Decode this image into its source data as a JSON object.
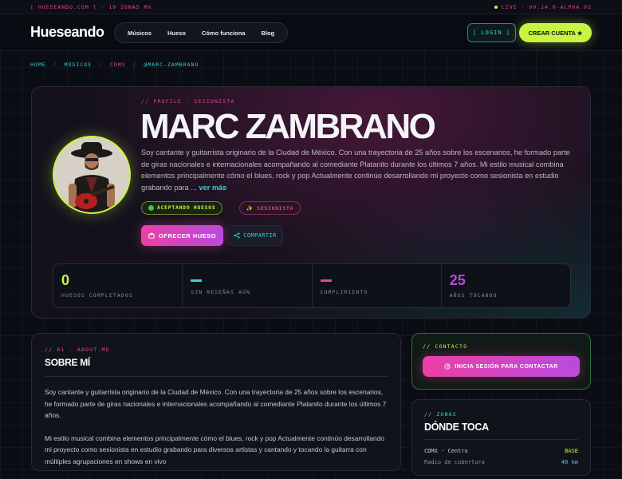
{
  "statusbar": {
    "left": "[ HUESEANDO.COM ] · 19 ZONAS MX",
    "right": "LIVE · V0.14.0-ALPHA.02"
  },
  "header": {
    "logo": "Hueseando",
    "nav": [
      {
        "label": "Músicos"
      },
      {
        "label": "Hueso"
      },
      {
        "label": "Cómo funciona"
      },
      {
        "label": "Blog"
      }
    ],
    "login_label": "[ LOGIN ]",
    "signup_label": "CREAR CUENTA ★"
  },
  "breadcrumb": [
    {
      "label": "HOME"
    },
    {
      "label": "MÚSICOS"
    },
    {
      "label": "CDMX"
    },
    {
      "label": "@MARC-ZAMBRANO"
    }
  ],
  "profile": {
    "label": "// PROFILE · SESIONISTA",
    "name": "MARC ZAMBRANO",
    "bio": "Soy cantante y guitarrista originario de la Ciudad de México. Con una trayectoria de 25 años sobre los escenarios, he formado parte de giras nacionales e internacionales acompañando al comediante Platanito durante los últimos 7 años. Mi estilo musical combina elementos principalmente cómo el blues, rock y pop Actualmente continúo desarrollando mi proyecto como sesionista en estudio grabando para ...",
    "more_label": "ver más",
    "tag_available": "ACEPTANDO HUESOS",
    "tag_role": "✨ SESIONISTA",
    "offer_label": "OFRECER HUESO",
    "offer_icon": "briefcase-icon",
    "share_label": "COMPARTIR",
    "share_icon": "share-icon"
  },
  "stats": [
    {
      "value": "0",
      "label": "HUESOS COMPLETADOS",
      "color": "#c7f542"
    },
    {
      "value": "",
      "label": "SIN RESEÑAS AÚN",
      "color": "#35d3d8"
    },
    {
      "value": "",
      "label": "CUMPLIMIENTO",
      "color": "#e04a8a"
    },
    {
      "value": "25",
      "label": "AÑOS TOCANDO",
      "color": "#b84be0"
    }
  ],
  "about": {
    "label": "// 01 · ABOUT.MD",
    "title": "SOBRE MÍ",
    "paragraphs": [
      "Soy cantante y guitarrista originario de la Ciudad de México. Con una trayectoria de 25 años sobre los escenarios, he formado parte de giras nacionales e internacionales acompañando al comediante Platanito durante los últimos 7 años.",
      "Mi estilo musical combina elementos principalmente cómo el blues, rock y pop Actualmente continúo desarrollando mi proyecto como sesionista en estudio grabando para diversos artistas y cantando y tocando la guitarra con múltiples agrupaciones en shows en vivo"
    ]
  },
  "contact": {
    "label": "// CONTACTO",
    "button_label": "INICIA SESIÓN PARA CONTACTAR"
  },
  "zonas": {
    "label": "// ZONAS",
    "title": "DÓNDE TOCA",
    "rows": [
      {
        "key": "CDMX · Centro",
        "value": "BASE"
      },
      {
        "key": "Radio de cobertura",
        "value": "40 km"
      }
    ]
  },
  "colors": {
    "lime": "#c7f542",
    "cyan": "#35d3d8",
    "pink": "#e04a8a",
    "purple": "#b84be0"
  }
}
